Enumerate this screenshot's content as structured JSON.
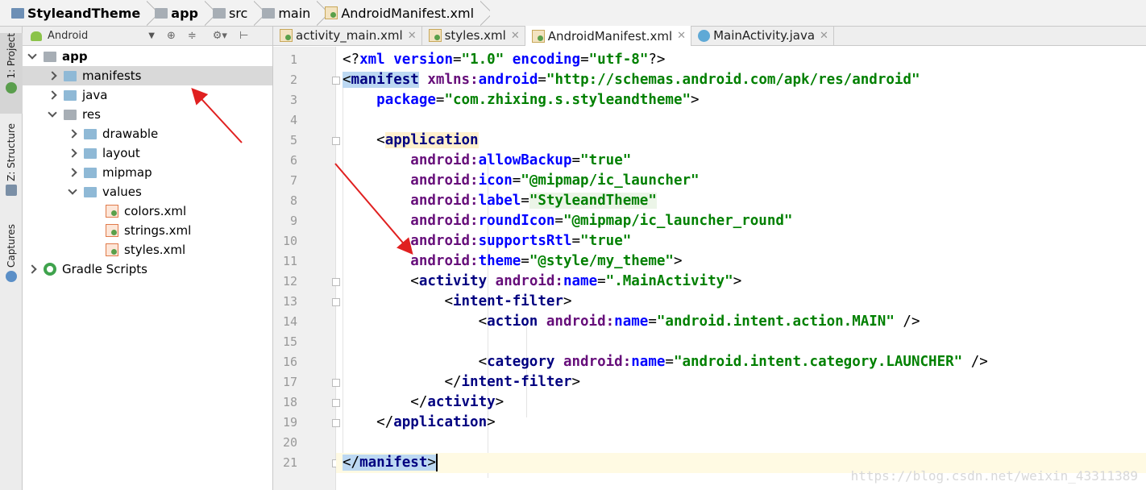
{
  "breadcrumb": [
    {
      "label": "StyleandTheme",
      "icon": "project-folder-icon"
    },
    {
      "label": "app",
      "icon": "module-folder-icon"
    },
    {
      "label": "src",
      "icon": "folder-icon"
    },
    {
      "label": "main",
      "icon": "folder-icon"
    },
    {
      "label": "AndroidManifest.xml",
      "icon": "manifest-file-icon"
    }
  ],
  "sidebar": {
    "tabs": [
      {
        "label": "1: Project"
      },
      {
        "label": "Z: Structure"
      },
      {
        "label": "Captures"
      }
    ]
  },
  "project_panel": {
    "view_mode": "Android",
    "tree": [
      {
        "label": "app",
        "depth": 0,
        "expanded": true,
        "icon": "module-folder-icon"
      },
      {
        "label": "manifests",
        "depth": 1,
        "expanded": false,
        "icon": "folder-icon",
        "selected": true
      },
      {
        "label": "java",
        "depth": 1,
        "expanded": false,
        "icon": "folder-icon"
      },
      {
        "label": "res",
        "depth": 1,
        "expanded": true,
        "icon": "res-folder-icon"
      },
      {
        "label": "drawable",
        "depth": 2,
        "expanded": false,
        "icon": "folder-icon"
      },
      {
        "label": "layout",
        "depth": 2,
        "expanded": false,
        "icon": "folder-icon"
      },
      {
        "label": "mipmap",
        "depth": 2,
        "expanded": false,
        "icon": "folder-icon"
      },
      {
        "label": "values",
        "depth": 2,
        "expanded": true,
        "icon": "folder-icon"
      },
      {
        "label": "colors.xml",
        "depth": 3,
        "icon": "xml-file-icon"
      },
      {
        "label": "strings.xml",
        "depth": 3,
        "icon": "xml-file-icon"
      },
      {
        "label": "styles.xml",
        "depth": 3,
        "icon": "xml-file-icon"
      },
      {
        "label": "Gradle Scripts",
        "depth": 0,
        "expanded": false,
        "icon": "gradle-icon"
      }
    ]
  },
  "editor": {
    "tabs": [
      {
        "label": "activity_main.xml",
        "active": false,
        "icon": "xml-file-icon"
      },
      {
        "label": "styles.xml",
        "active": false,
        "icon": "xml-file-icon"
      },
      {
        "label": "AndroidManifest.xml",
        "active": true,
        "icon": "manifest-file-icon"
      },
      {
        "label": "MainActivity.java",
        "active": false,
        "icon": "java-class-icon"
      }
    ],
    "line_numbers": [
      "1",
      "2",
      "3",
      "4",
      "5",
      "6",
      "7",
      "8",
      "9",
      "10",
      "11",
      "12",
      "13",
      "14",
      "15",
      "16",
      "17",
      "18",
      "19",
      "20",
      "21"
    ],
    "code": {
      "l1": [
        "<?",
        "xml ",
        "version",
        "=",
        "\"1.0\"",
        "encoding",
        "=",
        "\"utf-8\"",
        "?>"
      ],
      "l2": [
        "<",
        "manifest",
        " ",
        "xmlns:",
        "android",
        "=",
        "\"http://schemas.android.com/apk/res/android\""
      ],
      "l3": [
        "package",
        "=",
        "\"com.zhixing.s.styleandtheme\"",
        ">"
      ],
      "l5": [
        "<",
        "application"
      ],
      "l6": [
        "android:",
        "allowBackup",
        "=",
        "\"true\""
      ],
      "l7": [
        "android:",
        "icon",
        "=",
        "\"@mipmap/ic_launcher\""
      ],
      "l8": [
        "android:",
        "label",
        "=",
        "\"StyleandTheme\""
      ],
      "l9": [
        "android:",
        "roundIcon",
        "=",
        "\"@mipmap/ic_launcher_round\""
      ],
      "l10": [
        "android:",
        "supportsRtl",
        "=",
        "\"true\""
      ],
      "l11": [
        "android:",
        "theme",
        "=",
        "\"@style/my_theme\"",
        ">"
      ],
      "l12": [
        "<",
        "activity",
        " android:",
        "name",
        "=",
        "\".MainActivity\"",
        ">"
      ],
      "l13": [
        "<",
        "intent-filter",
        ">"
      ],
      "l14": [
        "<",
        "action",
        " android:",
        "name",
        "=",
        "\"android.intent.action.MAIN\"",
        " />"
      ],
      "l16": [
        "<",
        "category",
        " android:",
        "name",
        "=",
        "\"android.intent.category.LAUNCHER\"",
        " />"
      ],
      "l17": [
        "</",
        "intent-filter",
        ">"
      ],
      "l18": [
        "</",
        "activity",
        ">"
      ],
      "l19": [
        "</",
        "application",
        ">"
      ],
      "l21": [
        "</",
        "manifest",
        ">"
      ]
    }
  },
  "watermark": "https://blog.csdn.net/weixin_43311389",
  "colors": {
    "tag": "#000080",
    "namespace": "#660e7a",
    "attribute": "#0000ff",
    "value": "#008000",
    "annotation_arrow": "#e02020"
  }
}
